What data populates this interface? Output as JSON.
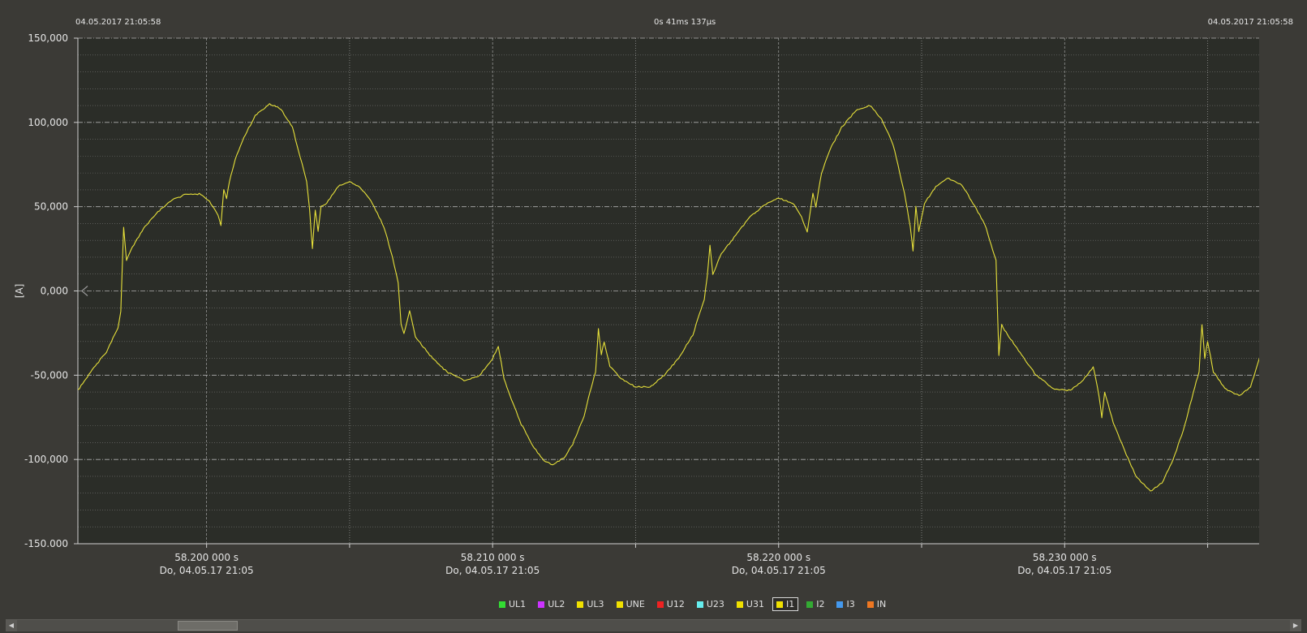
{
  "header": {
    "left_timestamp": "04.05.2017 21:05:58",
    "center_duration": "0s 41ms 137µs",
    "right_timestamp": "04.05.2017 21:05:58"
  },
  "colors": {
    "background": "#3b3a36",
    "plot_background": "#2b2d28",
    "grid_major": "#c8c8c8",
    "grid_minor": "#a8a8a8",
    "trace": "#e6e03a"
  },
  "legend": {
    "items": [
      {
        "label": "UL1",
        "color": "#33dd33"
      },
      {
        "label": "UL2",
        "color": "#cc33ff"
      },
      {
        "label": "UL3",
        "color": "#f0e000"
      },
      {
        "label": "UNE",
        "color": "#f0e000"
      },
      {
        "label": "U12",
        "color": "#ee2222"
      },
      {
        "label": "U23",
        "color": "#66eeee"
      },
      {
        "label": "U31",
        "color": "#f0e000"
      },
      {
        "label": "I1",
        "color": "#f0e000",
        "active": true
      },
      {
        "label": "I2",
        "color": "#33aa33"
      },
      {
        "label": "I3",
        "color": "#4499ee"
      },
      {
        "label": "IN",
        "color": "#ee7722"
      }
    ]
  },
  "scrollbar": {
    "left_icon": "arrow-left-icon",
    "right_icon": "arrow-right-icon"
  },
  "chart_data": {
    "type": "line",
    "title": "",
    "xlabel": "",
    "ylabel": "[A]",
    "ylim": [
      -150000,
      150000
    ],
    "xlim": [
      58.1955,
      58.2368
    ],
    "y_ticks": [
      150000,
      100000,
      50000,
      0,
      -50000,
      -100000,
      -150000
    ],
    "y_tick_labels": [
      "150,000",
      "100,000",
      "50,000",
      "0,000",
      "-50,000",
      "-100,000",
      "-150.000"
    ],
    "x_ticks": [
      58.2,
      58.21,
      58.22,
      58.23
    ],
    "x_tick_labels": [
      "58.200 000 s",
      "58.210 000 s",
      "58.220 000 s",
      "58.230 000 s"
    ],
    "x_tick_sublabels": [
      "Do, 04.05.17 21:05",
      "Do, 04.05.17 21:05",
      "Do, 04.05.17 21:05",
      "Do, 04.05.17 21:05"
    ],
    "grid": true,
    "series": [
      {
        "name": "I1",
        "color": "#e6e03a",
        "points": [
          [
            58.1955,
            -59000
          ],
          [
            58.196,
            -47000
          ],
          [
            58.1965,
            -36000
          ],
          [
            58.1969,
            -22000
          ],
          [
            58.197,
            -12000
          ],
          [
            58.1971,
            38000
          ],
          [
            58.1972,
            18000
          ],
          [
            58.1974,
            26000
          ],
          [
            58.1978,
            37000
          ],
          [
            58.1983,
            47000
          ],
          [
            58.1988,
            54000
          ],
          [
            58.1993,
            57500
          ],
          [
            58.1998,
            57500
          ],
          [
            58.2001,
            53000
          ],
          [
            58.2004,
            45000
          ],
          [
            58.2005,
            39000
          ],
          [
            58.2006,
            60000
          ],
          [
            58.2007,
            55000
          ],
          [
            58.2008,
            65000
          ],
          [
            58.201,
            78000
          ],
          [
            58.2013,
            91000
          ],
          [
            58.2017,
            104000
          ],
          [
            58.2022,
            111000
          ],
          [
            58.2026,
            108000
          ],
          [
            58.203,
            97000
          ],
          [
            58.2035,
            65000
          ],
          [
            58.2036,
            48000
          ],
          [
            58.2037,
            25000
          ],
          [
            58.2038,
            48000
          ],
          [
            58.2039,
            35000
          ],
          [
            58.204,
            50000
          ],
          [
            58.2042,
            52000
          ],
          [
            58.2046,
            62000
          ],
          [
            58.205,
            65000
          ],
          [
            58.2054,
            61000
          ],
          [
            58.2058,
            52000
          ],
          [
            58.2062,
            38000
          ],
          [
            58.2065,
            20000
          ],
          [
            58.2067,
            5000
          ],
          [
            58.2068,
            -20000
          ],
          [
            58.2069,
            -25000
          ],
          [
            58.2071,
            -12000
          ],
          [
            58.2073,
            -27000
          ],
          [
            58.2078,
            -38000
          ],
          [
            58.2084,
            -48000
          ],
          [
            58.209,
            -53000
          ],
          [
            58.2095,
            -51000
          ],
          [
            58.21,
            -40000
          ],
          [
            58.2102,
            -33000
          ],
          [
            58.2104,
            -52000
          ],
          [
            58.2106,
            -62000
          ],
          [
            58.211,
            -79000
          ],
          [
            58.2114,
            -92000
          ],
          [
            58.2118,
            -101000
          ],
          [
            58.2121,
            -103000
          ],
          [
            58.2125,
            -99000
          ],
          [
            58.2128,
            -91000
          ],
          [
            58.2132,
            -74000
          ],
          [
            58.2134,
            -60000
          ],
          [
            58.2136,
            -48000
          ],
          [
            58.2137,
            -22000
          ],
          [
            58.2138,
            -38000
          ],
          [
            58.2139,
            -30000
          ],
          [
            58.2141,
            -45000
          ],
          [
            58.2145,
            -52000
          ],
          [
            58.215,
            -57000
          ],
          [
            58.2155,
            -57000
          ],
          [
            58.216,
            -50000
          ],
          [
            58.2165,
            -40000
          ],
          [
            58.217,
            -26000
          ],
          [
            58.2174,
            -5000
          ],
          [
            58.2175,
            8000
          ],
          [
            58.2176,
            27000
          ],
          [
            58.2177,
            10000
          ],
          [
            58.218,
            22000
          ],
          [
            58.2185,
            33000
          ],
          [
            58.219,
            44000
          ],
          [
            58.2195,
            51000
          ],
          [
            58.22,
            55000
          ],
          [
            58.2205,
            52000
          ],
          [
            58.2208,
            44000
          ],
          [
            58.221,
            35000
          ],
          [
            58.2212,
            58000
          ],
          [
            58.2213,
            50000
          ],
          [
            58.2215,
            70000
          ],
          [
            58.2218,
            84000
          ],
          [
            58.2222,
            97000
          ],
          [
            58.2227,
            107000
          ],
          [
            58.2232,
            110000
          ],
          [
            58.2236,
            102000
          ],
          [
            58.224,
            87000
          ],
          [
            58.2244,
            58000
          ],
          [
            58.2246,
            38000
          ],
          [
            58.2247,
            24000
          ],
          [
            58.2248,
            50000
          ],
          [
            58.2249,
            35000
          ],
          [
            58.2251,
            52000
          ],
          [
            58.2255,
            62000
          ],
          [
            58.2259,
            67000
          ],
          [
            58.2264,
            63000
          ],
          [
            58.2268,
            52000
          ],
          [
            58.2272,
            40000
          ],
          [
            58.2276,
            18000
          ],
          [
            58.2277,
            -38000
          ],
          [
            58.2278,
            -20000
          ],
          [
            58.228,
            -26000
          ],
          [
            58.2285,
            -38000
          ],
          [
            58.229,
            -50000
          ],
          [
            58.2296,
            -58000
          ],
          [
            58.2302,
            -59000
          ],
          [
            58.2306,
            -54000
          ],
          [
            58.231,
            -45000
          ],
          [
            58.2312,
            -62000
          ],
          [
            58.2313,
            -75000
          ],
          [
            58.2314,
            -60000
          ],
          [
            58.2317,
            -78000
          ],
          [
            58.2321,
            -95000
          ],
          [
            58.2325,
            -110000
          ],
          [
            58.233,
            -119000
          ],
          [
            58.2334,
            -114000
          ],
          [
            58.2338,
            -100000
          ],
          [
            58.2342,
            -80000
          ],
          [
            58.2345,
            -60000
          ],
          [
            58.2347,
            -48000
          ],
          [
            58.2348,
            -20000
          ],
          [
            58.2349,
            -40000
          ],
          [
            58.235,
            -30000
          ],
          [
            58.2352,
            -48000
          ],
          [
            58.2356,
            -58000
          ],
          [
            58.2361,
            -62000
          ],
          [
            58.2365,
            -57000
          ],
          [
            58.2368,
            -40000
          ],
          [
            58.2372,
            -22000
          ]
        ]
      }
    ]
  }
}
